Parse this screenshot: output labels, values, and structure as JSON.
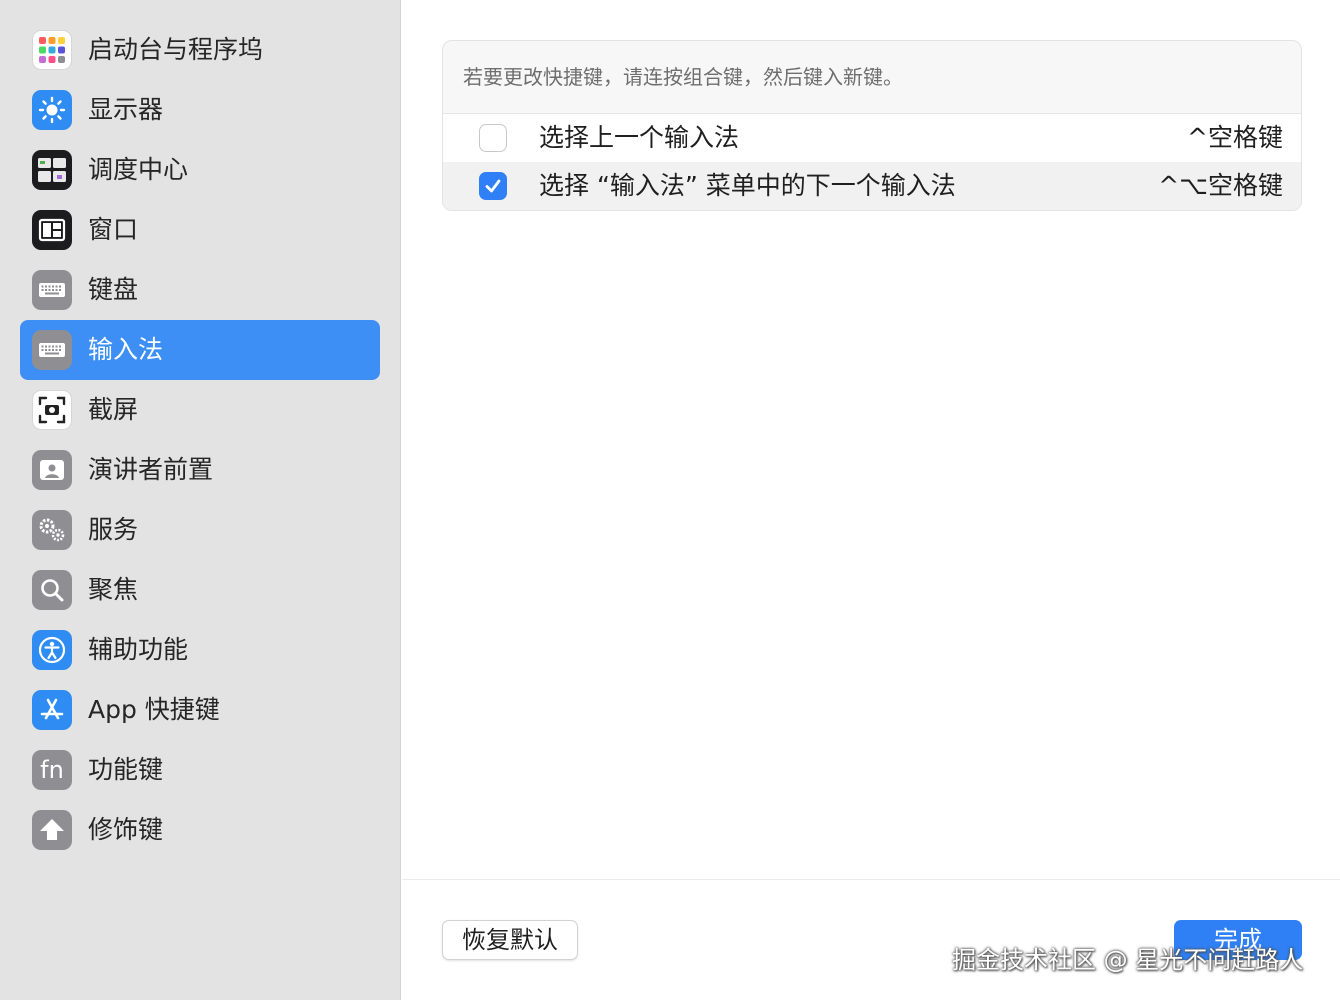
{
  "sidebar": {
    "items": [
      {
        "label": "启动台与程序坞",
        "icon": "launchpad-icon"
      },
      {
        "label": "显示器",
        "icon": "display-icon"
      },
      {
        "label": "调度中心",
        "icon": "mission-control-icon"
      },
      {
        "label": "窗口",
        "icon": "window-icon"
      },
      {
        "label": "键盘",
        "icon": "keyboard-icon"
      },
      {
        "label": "输入法",
        "icon": "keyboard-icon",
        "active": true
      },
      {
        "label": "截屏",
        "icon": "screenshot-icon"
      },
      {
        "label": "演讲者前置",
        "icon": "presenter-icon"
      },
      {
        "label": "服务",
        "icon": "gears-icon"
      },
      {
        "label": "聚焦",
        "icon": "spotlight-icon"
      },
      {
        "label": "辅助功能",
        "icon": "accessibility-icon"
      },
      {
        "label": "App 快捷键",
        "icon": "app-store-icon"
      },
      {
        "label": "功能键",
        "icon": "fn-icon"
      },
      {
        "label": "修饰键",
        "icon": "modifier-arrow-icon"
      }
    ]
  },
  "main": {
    "hint": "若要更改快捷键，请连按组合键，然后键入新键。",
    "shortcuts": [
      {
        "label": "选择上一个输入法",
        "key": "^空格键",
        "checked": false
      },
      {
        "label": "选择 “输入法” 菜单中的下一个输入法",
        "key": "^⌥空格键",
        "checked": true
      }
    ],
    "reset_label": "恢复默认",
    "done_label": "完成"
  },
  "watermark": "掘金技术社区 @ 星光不问赶路人",
  "colors": {
    "accent": "#3d8ff5",
    "sidebar_bg": "#e4e3e3",
    "checkbox": "#2f7ff7"
  },
  "fn_icon_text": "fn"
}
